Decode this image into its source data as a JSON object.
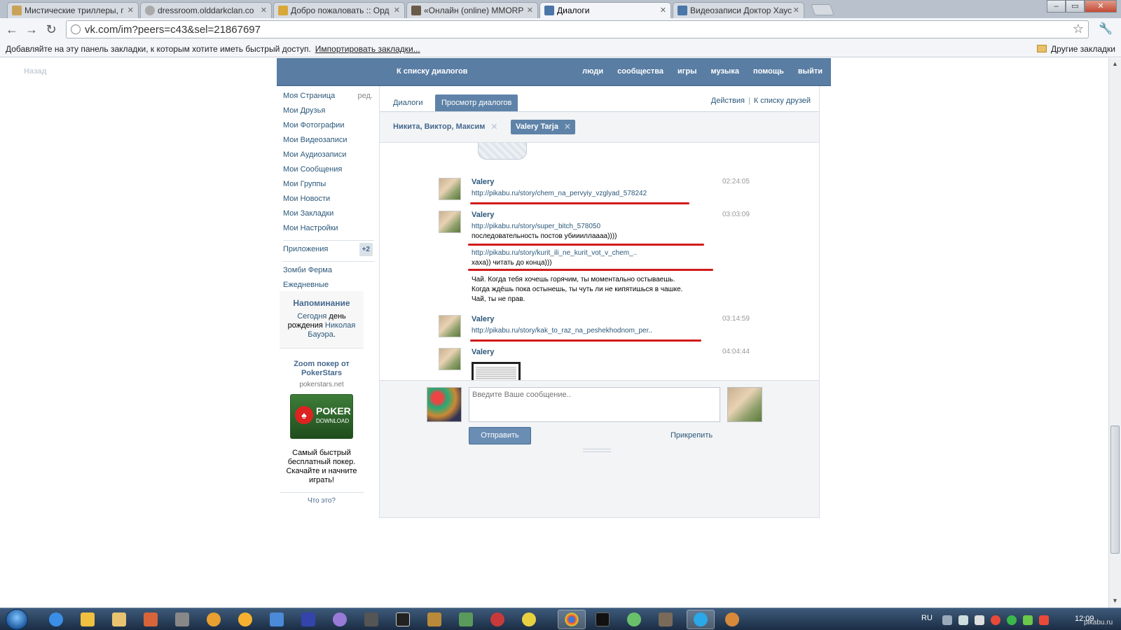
{
  "browser": {
    "tabs": [
      {
        "title": "Мистические триллеры, г",
        "active": false
      },
      {
        "title": "dressroom.olddarkclan.co",
        "active": false
      },
      {
        "title": "Добро пожаловать :: Орд",
        "active": false
      },
      {
        "title": "«Онлайн (online) MMORP",
        "active": false
      },
      {
        "title": "Диалоги",
        "active": true
      },
      {
        "title": "Видеозаписи Доктор Хаус",
        "active": false
      }
    ],
    "url": "vk.com/im?peers=c43&sel=21867697",
    "bookmarks_hint": "Добавляйте на эту панель закладки, к которым хотите иметь быстрый доступ.",
    "import_bookmarks": "Импортировать закладки...",
    "other_bookmarks": "Другие закладки"
  },
  "page": {
    "back_link": "Назад",
    "header": {
      "back_to_list": "К списку диалогов",
      "links": [
        "люди",
        "сообщества",
        "игры",
        "музыка",
        "помощь",
        "выйти"
      ]
    },
    "left_nav": {
      "items": [
        "Моя Страница",
        "Мои Друзья",
        "Мои Фотографии",
        "Мои Видеозаписи",
        "Мои Аудиозаписи",
        "Мои Сообщения",
        "Мои Группы",
        "Мои Новости",
        "Мои Закладки",
        "Мои Настройки"
      ],
      "edit": "ред.",
      "apps_label": "Приложения",
      "apps_badge": "+2",
      "apps": [
        "Зомби Ферма",
        "Ежедневные"
      ]
    },
    "reminder": {
      "title": "Напоминание",
      "today": "Сегодня",
      "text_mid": " день рождения ",
      "person": "Николая Бауэра",
      "end": "."
    },
    "ad": {
      "title": "Zoom покер от PokerStars",
      "domain": "pokerstars.net",
      "img_text": "POKER",
      "img_sub": "DOWNLOAD",
      "description": "Самый быстрый бесплатный покер. Скачайте и начните играть!",
      "what_is_it": "Что это?"
    },
    "dialog": {
      "tabs": [
        "Диалоги",
        "Просмотр диалогов"
      ],
      "actions": "Действия",
      "to_friends": "К списку друзей",
      "peers": [
        {
          "name": "Никита, Виктор, Максим",
          "active": false
        },
        {
          "name": "Valery Tarja",
          "active": true
        }
      ],
      "messages": [
        {
          "author": "Valery",
          "time": "02:24:05",
          "lines": [
            "http://pikabu.ru/story/chem_na_pervyiy_vzglyad_578242"
          ]
        },
        {
          "author": "Valery",
          "time": "03:03:09",
          "lines": [
            "http://pikabu.ru/story/super_bitch_578050",
            "последовательность постов убиииллаааа))))",
            "http://pikabu.ru/story/kurit_ili_ne_kurit_vot_v_chem_..",
            "хаха)) читать до конца)))",
            "Чай. Когда тебя хочешь горячим, ты моментально остываешь.",
            "Когда ждёшь пока остынешь, ты чуть ли не кипятишься в чашке.",
            "Чай, ты не прав."
          ]
        },
        {
          "author": "Valery",
          "time": "03:14:59",
          "lines": [
            "http://pikabu.ru/story/kak_to_raz_na_peshekhodnom_per.."
          ]
        },
        {
          "author": "Valery",
          "time": "04:04:44",
          "lines": []
        }
      ],
      "compose": {
        "placeholder": "Введите Ваше сообщение..",
        "send": "Отправить",
        "attach": "Прикрепить"
      }
    }
  },
  "taskbar": {
    "lang": "RU",
    "clock": "12:09"
  },
  "watermark": "pikabu.ru",
  "colors": {
    "vk_blue": "#597da3",
    "link": "#2b587a",
    "red_underline": "#d21a1a"
  }
}
